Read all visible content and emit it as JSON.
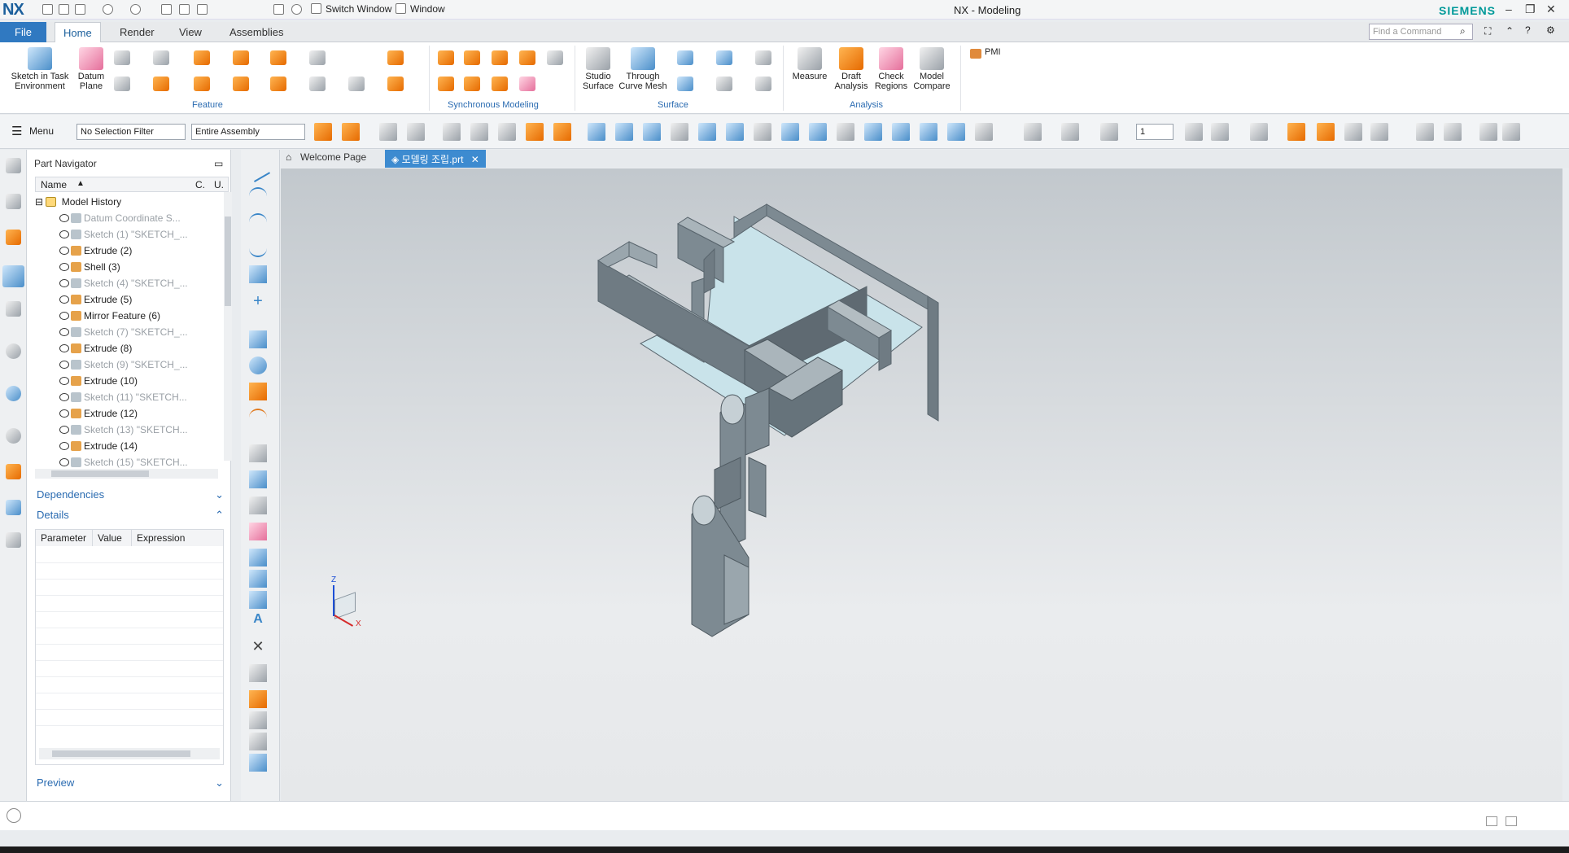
{
  "titlebar": {
    "logo": "NX",
    "switch_window": "Switch Window",
    "window_menu": "Window",
    "title": "NX - Modeling",
    "brand": "SIEMENS"
  },
  "tabs": {
    "file": "File",
    "home": "Home",
    "render": "Render",
    "view": "View",
    "assemblies": "Assemblies",
    "find_placeholder": "Find a Command"
  },
  "ribbon": {
    "sketch": "Sketch in Task",
    "sketch2": "Environment",
    "datum": "Datum",
    "datum2": "Plane",
    "feature_group": "Feature",
    "sync_group": "Synchronous Modeling",
    "studio": "Studio",
    "studio2": "Surface",
    "through": "Through",
    "through2": "Curve Mesh",
    "surface_group": "Surface",
    "measure": "Measure",
    "draft": "Draft",
    "draft2": "Analysis",
    "check": "Check",
    "check2": "Regions",
    "model": "Model",
    "model2": "Compare",
    "analysis_group": "Analysis",
    "pmi": "PMI"
  },
  "cmdbar": {
    "menu": "Menu",
    "selection_filter": "No Selection Filter",
    "scope": "Entire Assembly",
    "layer": "1"
  },
  "navigator": {
    "title": "Part Navigator",
    "col_name": "Name",
    "col_c": "C.",
    "col_u": "U.",
    "root": "Model History",
    "items": [
      {
        "label": "Datum Coordinate S...",
        "dim": true
      },
      {
        "label": "Sketch (1) \"SKETCH_...",
        "dim": true
      },
      {
        "label": "Extrude (2)",
        "dim": false
      },
      {
        "label": "Shell (3)",
        "dim": false
      },
      {
        "label": "Sketch (4) \"SKETCH_...",
        "dim": true
      },
      {
        "label": "Extrude (5)",
        "dim": false
      },
      {
        "label": "Mirror Feature (6)",
        "dim": false
      },
      {
        "label": "Sketch (7) \"SKETCH_...",
        "dim": true
      },
      {
        "label": "Extrude (8)",
        "dim": false
      },
      {
        "label": "Sketch (9) \"SKETCH_...",
        "dim": true
      },
      {
        "label": "Extrude (10)",
        "dim": false
      },
      {
        "label": "Sketch (11) \"SKETCH...",
        "dim": true
      },
      {
        "label": "Extrude (12)",
        "dim": false
      },
      {
        "label": "Sketch (13) \"SKETCH...",
        "dim": true
      },
      {
        "label": "Extrude (14)",
        "dim": false
      },
      {
        "label": "Sketch (15) \"SKETCH...",
        "dim": true
      }
    ],
    "dependencies": "Dependencies",
    "details": "Details",
    "param": "Parameter",
    "value": "Value",
    "expression": "Expression",
    "preview": "Preview"
  },
  "viewport": {
    "welcome_tab": "Welcome Page",
    "part_tab": "모델링 조립.prt",
    "axis_z": "Z",
    "axis_x": "X"
  }
}
